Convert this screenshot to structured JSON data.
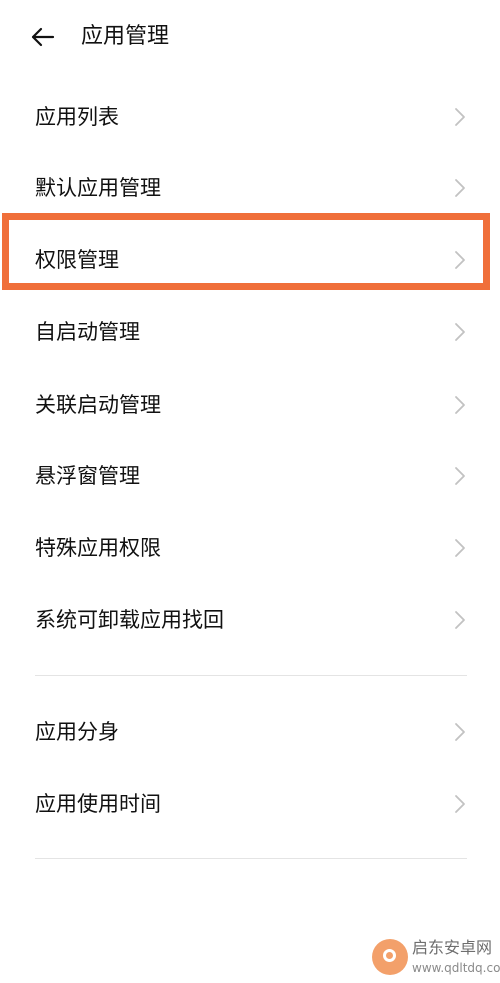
{
  "header": {
    "title": "应用管理",
    "back_icon": "arrow-left-icon"
  },
  "menu": {
    "group1": [
      {
        "label": "应用列表"
      },
      {
        "label": "默认应用管理"
      },
      {
        "label": "权限管理"
      },
      {
        "label": "自启动管理"
      },
      {
        "label": "关联启动管理"
      },
      {
        "label": "悬浮窗管理"
      },
      {
        "label": "特殊应用权限"
      },
      {
        "label": "系统可卸载应用找回"
      }
    ],
    "group2": [
      {
        "label": "应用分身"
      },
      {
        "label": "应用使用时间"
      }
    ],
    "chevron_icon": "chevron-right-icon"
  },
  "highlight": {
    "color": "#f06f3a",
    "target": "权限管理"
  },
  "watermark": {
    "name": "启东安卓网",
    "url": "www.qdltdq.com"
  }
}
